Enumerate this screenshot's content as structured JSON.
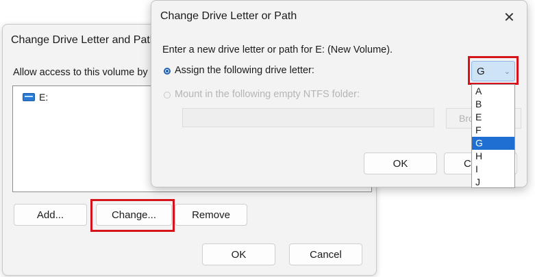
{
  "back_dialog": {
    "title": "Change Drive Letter and Path",
    "allow_text": "Allow access to this volume by",
    "list_items": [
      "E:"
    ],
    "buttons": {
      "add": "Add...",
      "change": "Change...",
      "remove": "Remove",
      "ok": "OK",
      "cancel": "Cancel"
    }
  },
  "front_dialog": {
    "title": "Change Drive Letter or Path",
    "close_glyph": "✕",
    "prompt": "Enter a new drive letter or path for E: (New Volume).",
    "option_assign": "Assign the following drive letter:",
    "option_mount": "Mount in the following empty NTFS folder:",
    "browse_label": "Bro",
    "buttons": {
      "ok": "OK",
      "cancel": "C"
    },
    "drive_select": {
      "selected": "G",
      "chevron": "⌄",
      "options": [
        "A",
        "B",
        "E",
        "F",
        "G",
        "H",
        "I",
        "J"
      ]
    }
  },
  "colors": {
    "highlight_box": "#d6121b",
    "selection": "#1e6fd1",
    "select_bg": "#cfe3f7"
  }
}
